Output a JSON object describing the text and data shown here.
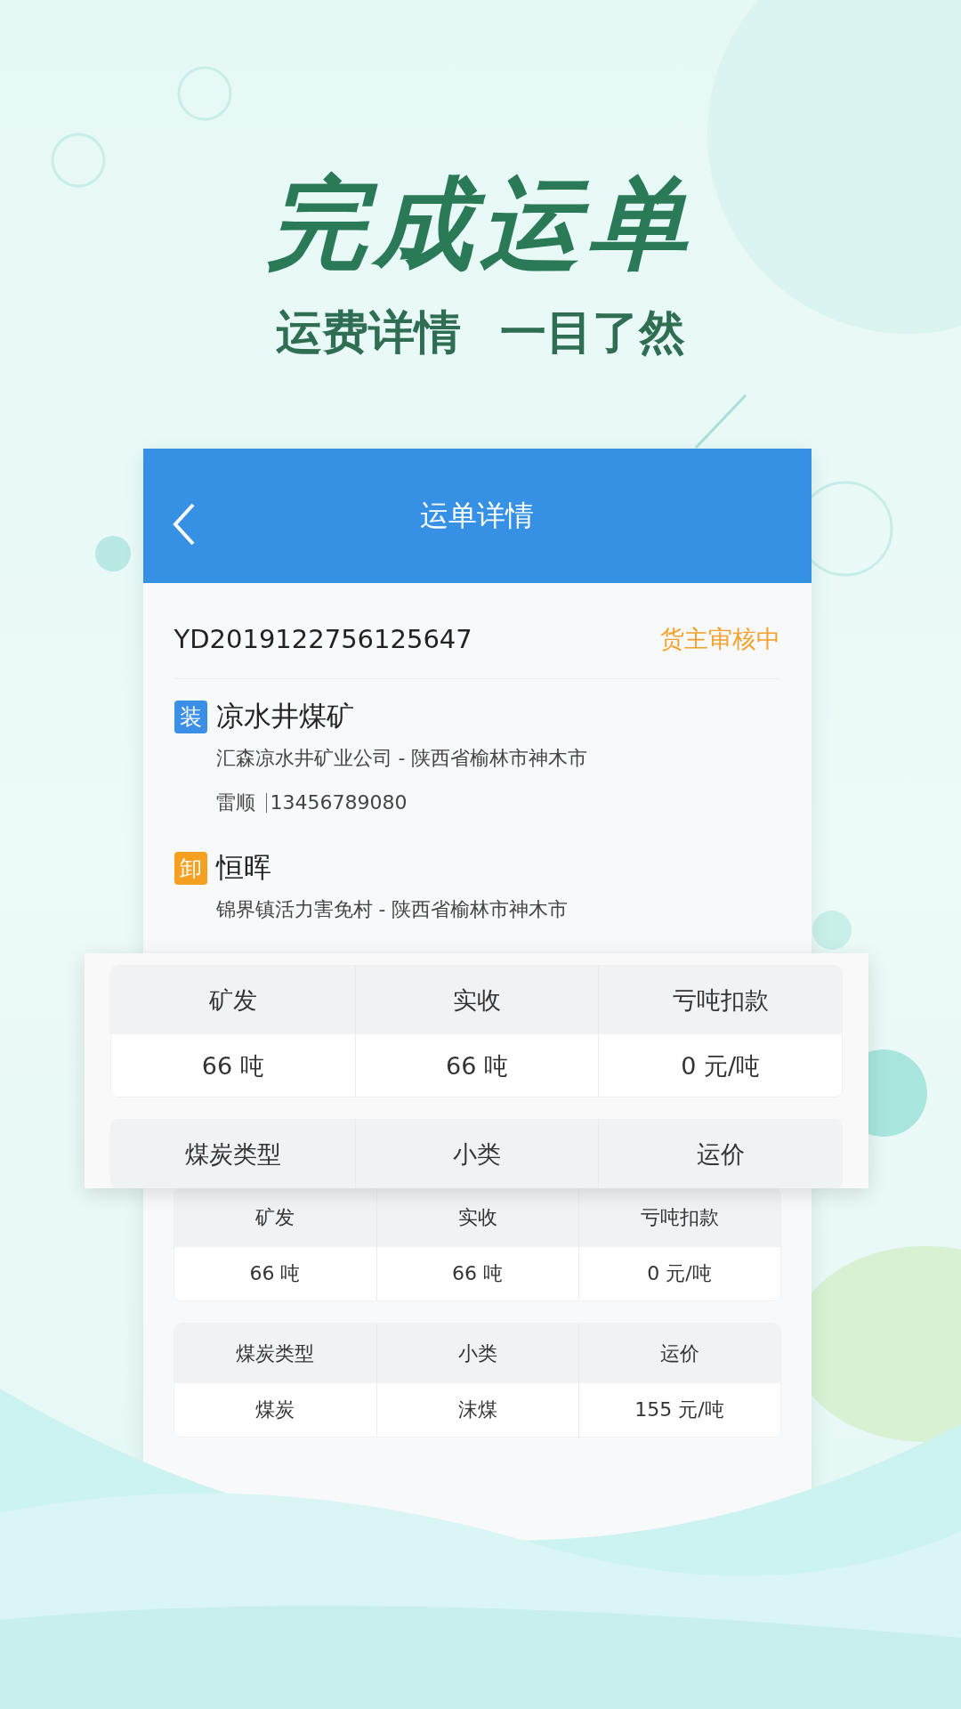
{
  "headline": {
    "title": "完成运单",
    "subtitle": [
      "运费详情",
      "一目了然"
    ]
  },
  "screen": {
    "nav": {
      "title": "运单详情"
    },
    "order": {
      "number": "YD2019122756125647",
      "status": "货主审核中"
    },
    "stops": [
      {
        "kind": "load",
        "badge": "装",
        "name": "凉水井煤矿",
        "address": "汇森凉水井矿业公司 - 陕西省榆林市神木市",
        "contact": "雷顺",
        "phone": "13456789080"
      },
      {
        "kind": "unload",
        "badge": "卸",
        "name": "恒晖",
        "address": "锦界镇活力害免村 - 陕西省榆林市神木市"
      }
    ],
    "tables": [
      {
        "columns": [
          "矿发",
          "实收",
          "亏吨扣款"
        ],
        "values": [
          "66 吨",
          "66 吨",
          "0 元/吨"
        ]
      },
      {
        "columns": [
          "煤炭类型",
          "小类",
          "运价"
        ],
        "values": [
          "煤炭",
          "沫煤",
          "155 元/吨"
        ]
      }
    ]
  },
  "magnifier": {
    "tables": [
      {
        "columns": [
          "矿发",
          "实收",
          "亏吨扣款"
        ],
        "values": [
          "66 吨",
          "66 吨",
          "0 元/吨"
        ]
      },
      {
        "columns": [
          "煤炭类型",
          "小类",
          "运价"
        ]
      }
    ]
  }
}
